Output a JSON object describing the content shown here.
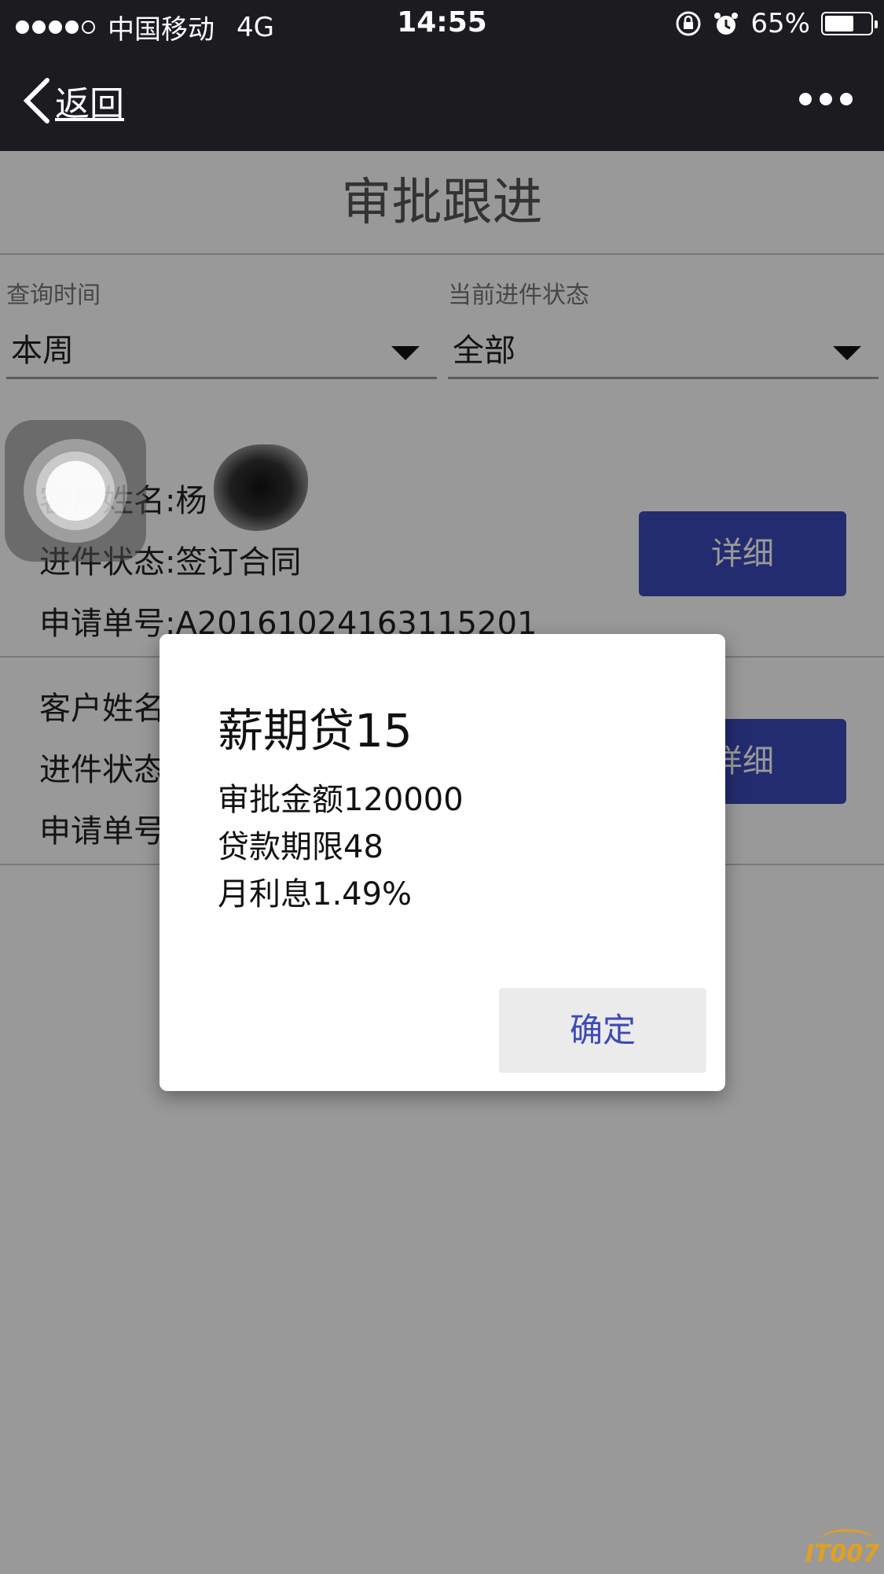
{
  "status_bar": {
    "carrier": "中国移动",
    "network": "4G",
    "time": "14:55",
    "battery": "65%",
    "battery_level": 0.65
  },
  "nav": {
    "back_label": "返回"
  },
  "page": {
    "title": "审批跟进"
  },
  "filters": {
    "time_label": "查询时间",
    "time_value": "本周",
    "status_label": "当前进件状态",
    "status_value": "全部"
  },
  "records": [
    {
      "customer": "客户姓名:杨",
      "status": "进件状态:签订合同",
      "app_no": "申请单号:A20161024163115201",
      "detail_label": "详细"
    },
    {
      "customer": "客户姓名",
      "status": "进件状态",
      "app_no": "申请单号",
      "detail_label": "详细"
    }
  ],
  "dialog": {
    "title": "薪期贷15",
    "line1": "审批金额120000",
    "line2": "贷款期限48",
    "line3": "月利息1.49%",
    "confirm_label": "确定"
  },
  "watermark": "IT007",
  "colors": {
    "accent": "#3b4ab8",
    "bar": "#1b1b20"
  }
}
